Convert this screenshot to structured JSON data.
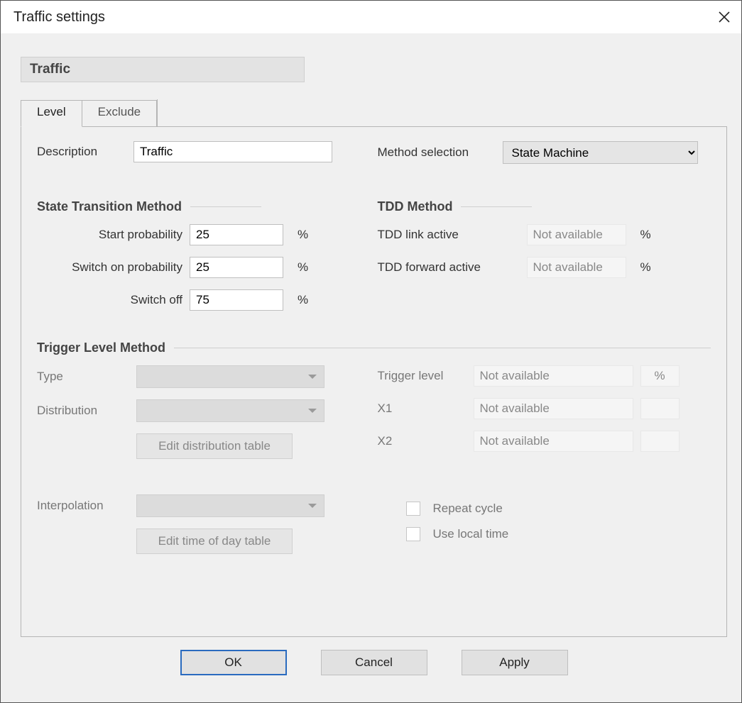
{
  "window": {
    "title": "Traffic settings"
  },
  "section": {
    "title": "Traffic"
  },
  "tabs": {
    "level": "Level",
    "exclude": "Exclude"
  },
  "level": {
    "description_label": "Description",
    "description_value": "Traffic",
    "method_selection_label": "Method selection",
    "method_selection_value": "State Machine",
    "pct": "%",
    "state_transition": {
      "title": "State Transition Method",
      "start_probability_label": "Start probability",
      "start_probability_value": "25",
      "switch_on_label": "Switch on probability",
      "switch_on_value": "25",
      "switch_off_label": "Switch off",
      "switch_off_value": "75"
    },
    "tdd": {
      "title": "TDD Method",
      "link_active_label": "TDD link active",
      "link_active_value": "Not available",
      "forward_active_label": "TDD forward active",
      "forward_active_value": "Not available"
    },
    "trigger": {
      "title": "Trigger Level Method",
      "type_label": "Type",
      "distribution_label": "Distribution",
      "edit_distribution_btn": "Edit distribution table",
      "interpolation_label": "Interpolation",
      "edit_tod_btn": "Edit time of day table",
      "trigger_level_label": "Trigger level",
      "trigger_level_value": "Not available",
      "trigger_level_unit": "%",
      "x1_label": "X1",
      "x1_value": "Not available",
      "x2_label": "X2",
      "x2_value": "Not available",
      "repeat_cycle_label": "Repeat cycle",
      "use_local_time_label": "Use local time"
    }
  },
  "buttons": {
    "ok": "OK",
    "cancel": "Cancel",
    "apply": "Apply"
  }
}
